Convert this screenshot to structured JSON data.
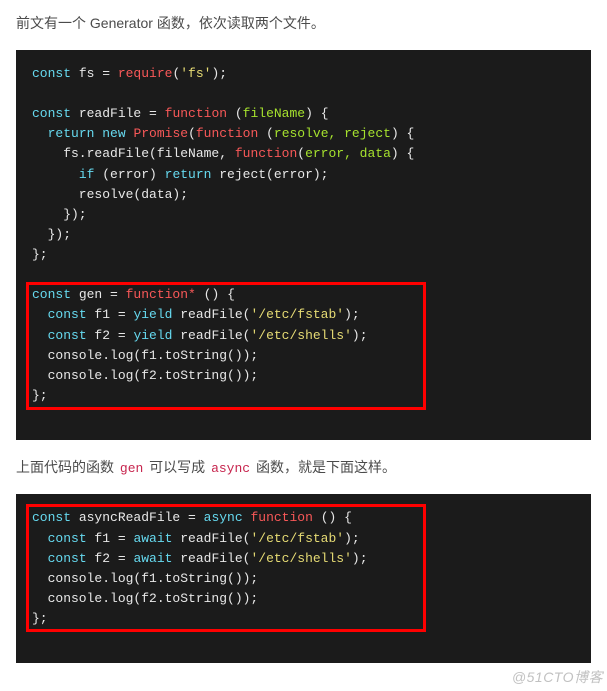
{
  "para1_a": "前文有一个 Generator 函数，依次读取两个文件。",
  "para2_a": "上面代码的函数 ",
  "para2_code1": "gen",
  "para2_b": " 可以写成 ",
  "para2_code2": "async",
  "para2_c": " 函数，就是下面这样。",
  "watermark": "@51CTO博客",
  "code1": {
    "l01a": "const",
    "l01b": " fs = ",
    "l01c": "require",
    "l01d": "(",
    "l01e": "'fs'",
    "l01f": ");",
    "l03a": "const",
    "l03b": " readFile = ",
    "l03c": "function",
    "l03d": " (",
    "l03e": "fileName",
    "l03f": ") {",
    "l04a": "  ",
    "l04b": "return",
    "l04c": " ",
    "l04d": "new",
    "l04e": " ",
    "l04f": "Promise",
    "l04g": "(",
    "l04h": "function",
    "l04i": " (",
    "l04j": "resolve, reject",
    "l04k": ") {",
    "l05a": "    fs.readFile(fileName, ",
    "l05b": "function",
    "l05c": "(",
    "l05d": "error, data",
    "l05e": ") {",
    "l06a": "      ",
    "l06b": "if",
    "l06c": " (error) ",
    "l06d": "return",
    "l06e": " reject(error);",
    "l07a": "      resolve(data);",
    "l08a": "    });",
    "l09a": "  });",
    "l10a": "};",
    "l12a": "const",
    "l12b": " gen = ",
    "l12c": "function",
    "l12d": "*",
    "l12e": " () {",
    "l13a": "  ",
    "l13b": "const",
    "l13c": " f1 = ",
    "l13d": "yield",
    "l13e": " readFile(",
    "l13f": "'/etc/fstab'",
    "l13g": ");",
    "l14a": "  ",
    "l14b": "const",
    "l14c": " f2 = ",
    "l14d": "yield",
    "l14e": " readFile(",
    "l14f": "'/etc/shells'",
    "l14g": ");",
    "l15a": "  console.log(f1.toString());",
    "l16a": "  console.log(f2.toString());",
    "l17a": "};"
  },
  "code2": {
    "l01a": "const",
    "l01b": " asyncReadFile = ",
    "l01c": "async",
    "l01d": " ",
    "l01e": "function",
    "l01f": " () {",
    "l02a": "  ",
    "l02b": "const",
    "l02c": " f1 = ",
    "l02d": "await",
    "l02e": " readFile(",
    "l02f": "'/etc/fstab'",
    "l02g": ");",
    "l03a": "  ",
    "l03b": "const",
    "l03c": " f2 = ",
    "l03d": "await",
    "l03e": " readFile(",
    "l03f": "'/etc/shells'",
    "l03g": ");",
    "l04a": "  console.log(f1.toString());",
    "l05a": "  console.log(f2.toString());",
    "l06a": "};"
  }
}
